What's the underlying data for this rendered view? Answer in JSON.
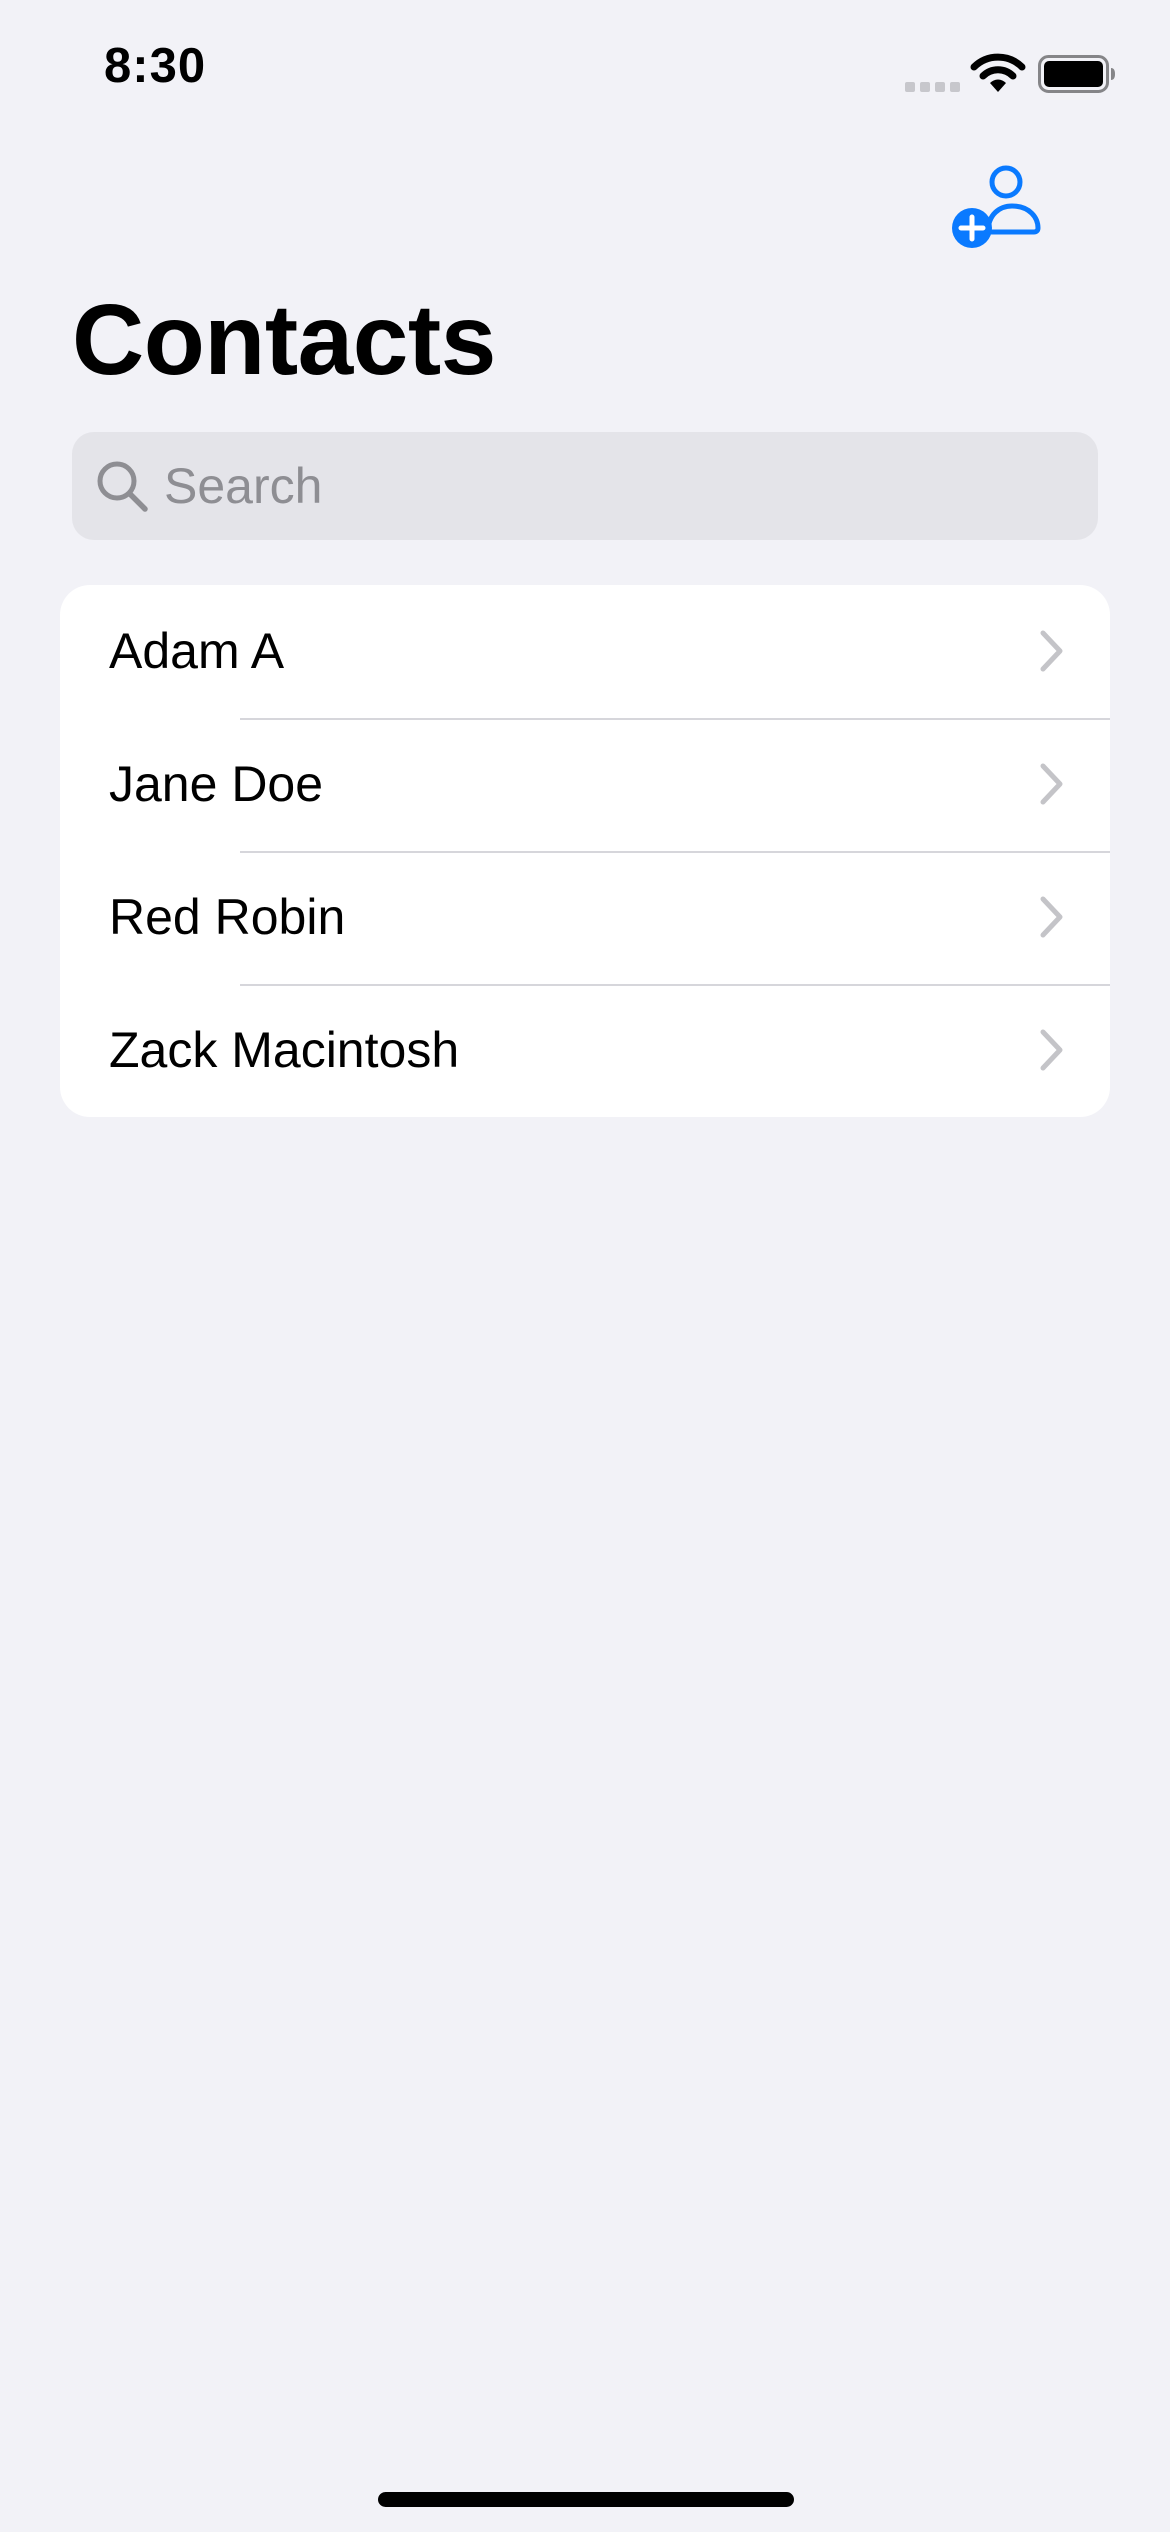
{
  "status_bar": {
    "time": "8:30",
    "icons": [
      "cellular-signal-icon",
      "wifi-icon",
      "battery-icon"
    ]
  },
  "header": {
    "add_button_icon": "add-person-icon",
    "title": "Contacts"
  },
  "search": {
    "placeholder": "Search",
    "value": "",
    "icon": "search-icon"
  },
  "contacts": [
    {
      "name": "Adam A"
    },
    {
      "name": "Jane Doe"
    },
    {
      "name": "Red Robin"
    },
    {
      "name": "Zack Macintosh"
    }
  ],
  "colors": {
    "background": "#f2f2f7",
    "accent": "#0a7aff",
    "search_background": "#e4e4e9",
    "separator": "#d6d6db",
    "chevron": "#c4c4c8",
    "placeholder": "#8e8e93"
  }
}
